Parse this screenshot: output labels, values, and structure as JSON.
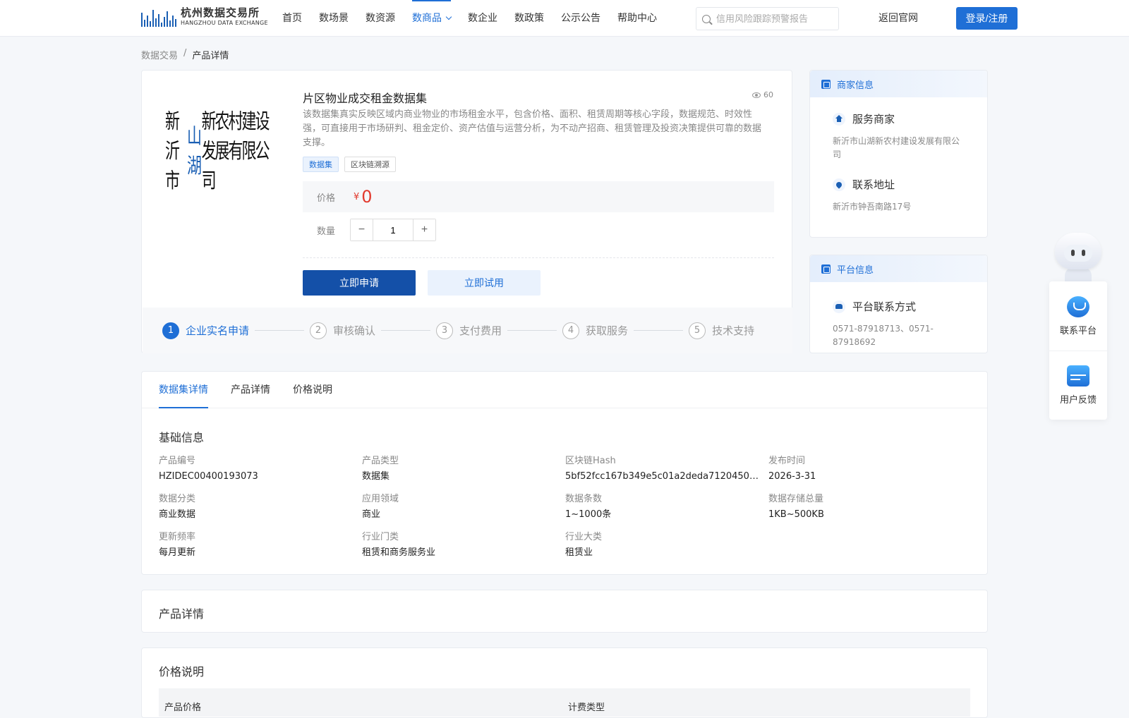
{
  "header": {
    "logo_cn": "杭州数据交易所",
    "logo_en": "HANGZHOU DATA EXCHANGE",
    "nav": [
      {
        "label": "首页"
      },
      {
        "label": "数场景"
      },
      {
        "label": "数资源"
      },
      {
        "label": "数商品",
        "active": true
      },
      {
        "label": "数企业"
      },
      {
        "label": "数政策"
      },
      {
        "label": "公示公告"
      },
      {
        "label": "帮助中心"
      }
    ],
    "search_placeholder": "信用风险跟踪预警报告",
    "return_label": "返回官网",
    "login_label": "登录/注册"
  },
  "breadcrumb": {
    "root": "数据交易",
    "sep": "/",
    "current": "产品详情"
  },
  "product": {
    "image_text_pre": "新沂市",
    "image_text_hl": "山湖",
    "image_text_post": "新农村建设发展有限公司",
    "title": "片区物业成交租金数据集",
    "views": "60",
    "description": "该数据集真实反映区域内商业物业的市场租金水平，包含价格、面积、租赁周期等核心字段，数据规范、时效性强，可直接用于市场研判、租金定价、资产估值与运营分析，为不动产招商、租赁管理及投资决策提供可靠的数据支撑。",
    "tags": [
      "数据集",
      "区块链溯源"
    ],
    "price_label": "价格",
    "currency": "¥",
    "price": "0",
    "qty_label": "数量",
    "qty": "1",
    "apply_label": "立即申请",
    "trial_label": "立即试用",
    "steps": [
      {
        "num": "1",
        "label": "企业实名申请"
      },
      {
        "num": "2",
        "label": "审核确认"
      },
      {
        "num": "3",
        "label": "支付费用"
      },
      {
        "num": "4",
        "label": "获取服务"
      },
      {
        "num": "5",
        "label": "技术支持"
      }
    ]
  },
  "merchant": {
    "header": "商家信息",
    "service_title": "服务商家",
    "service_name": "新沂市山湖新农村建设发展有限公司",
    "address_title": "联系地址",
    "address": "新沂市钟吾南路17号"
  },
  "platform": {
    "header": "平台信息",
    "contact_title": "平台联系方式",
    "phone": "0571-87918713、0571-87918692"
  },
  "tabs": [
    {
      "label": "数据集详情",
      "active": true
    },
    {
      "label": "产品详情"
    },
    {
      "label": "价格说明"
    }
  ],
  "basic": {
    "title": "基础信息",
    "fields": [
      {
        "label": "产品编号",
        "value": "HZIDEC00400193073"
      },
      {
        "label": "产品类型",
        "value": "数据集"
      },
      {
        "label": "区块链Hash",
        "value": "5bf52fcc167b349e5c01a2deda7120450b4..."
      },
      {
        "label": "发布时间",
        "value": "2026-3-31"
      },
      {
        "label": "数据分类",
        "value": "商业数据"
      },
      {
        "label": "应用领域",
        "value": "商业"
      },
      {
        "label": "数据条数",
        "value": "1~1000条"
      },
      {
        "label": "数据存储总量",
        "value": "1KB~500KB"
      },
      {
        "label": "更新频率",
        "value": "每月更新"
      },
      {
        "label": "行业门类",
        "value": "租赁和商务服务业"
      },
      {
        "label": "行业大类",
        "value": "租赁业"
      }
    ]
  },
  "detail_section": {
    "title": "产品详情"
  },
  "price_section": {
    "title": "价格说明",
    "col1": "产品价格",
    "col2": "计费类型"
  },
  "float": {
    "contact": "联系平台",
    "feedback": "用户反馈"
  }
}
